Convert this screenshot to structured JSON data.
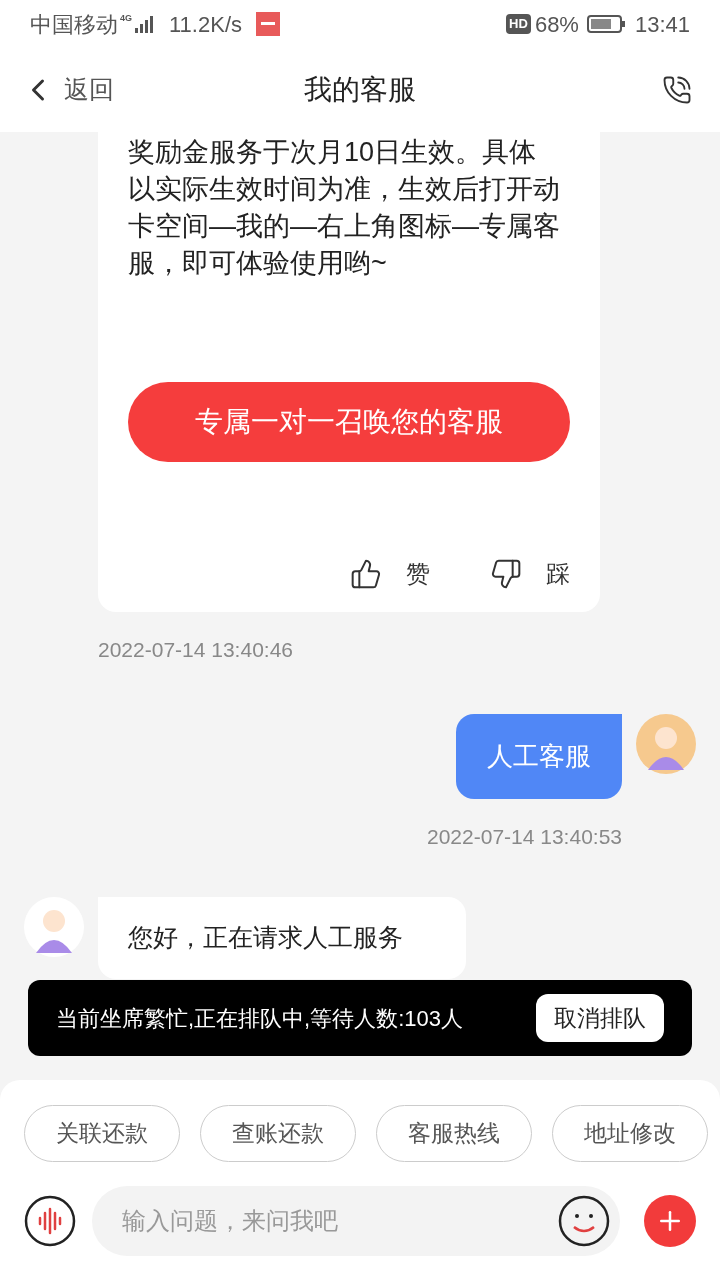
{
  "status_bar": {
    "carrier": "中国移动",
    "network": "4G",
    "speed": "11.2K/s",
    "hd": "HD",
    "battery": "68%",
    "time": "13:41"
  },
  "nav": {
    "back": "返回",
    "title": "我的客服"
  },
  "messages": [
    {
      "kind": "card",
      "text": "奖励金服务于次月10日生效。具体以实际生效时间为准，生效后打开动卡空间—我的—右上角图标—专属客服，即可体验使用哟~",
      "button": "专属一对一召唤您的客服",
      "like": "赞",
      "dislike": "踩"
    },
    {
      "kind": "stamp_left",
      "text": "2022-07-14 13:40:46"
    },
    {
      "kind": "user",
      "text": "人工客服"
    },
    {
      "kind": "stamp_right",
      "text": "2022-07-14 13:40:53"
    },
    {
      "kind": "bot",
      "text": "您好，正在请求人工服务"
    }
  ],
  "queue": {
    "text": "当前坐席繁忙,正在排队中,等待人数:103人",
    "button": "取消排队"
  },
  "quick_replies": [
    "关联还款",
    "查账还款",
    "客服热线",
    "地址修改"
  ],
  "input": {
    "placeholder": "输入问题，来问我吧"
  }
}
